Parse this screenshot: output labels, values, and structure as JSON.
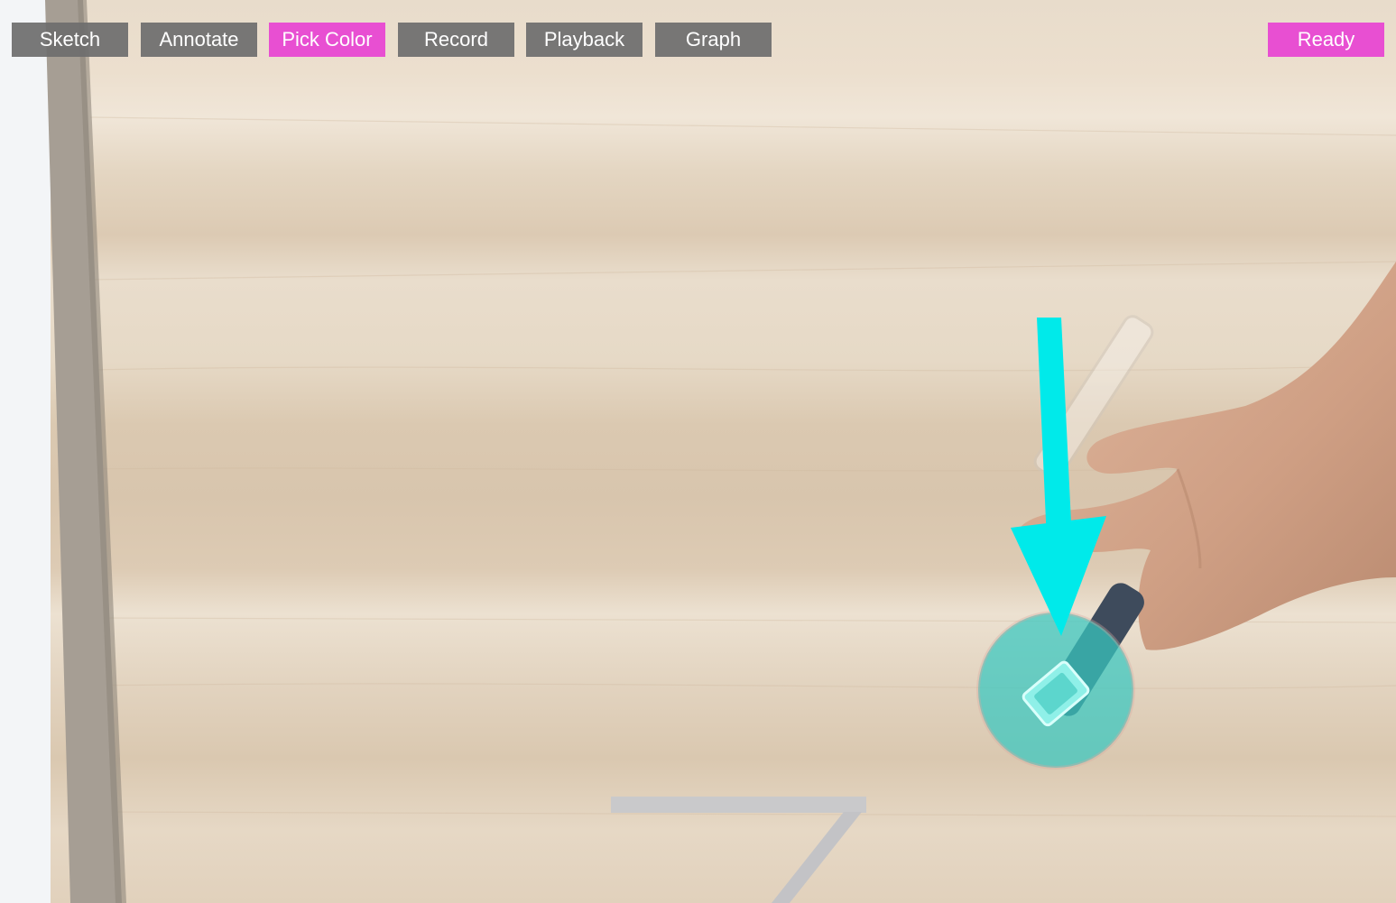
{
  "toolbar": {
    "buttons": [
      {
        "id": "sketch",
        "label": "Sketch",
        "active": false
      },
      {
        "id": "annotate",
        "label": "Annotate",
        "active": false
      },
      {
        "id": "pick_color",
        "label": "Pick Color",
        "active": true
      },
      {
        "id": "record",
        "label": "Record",
        "active": false
      },
      {
        "id": "playback",
        "label": "Playback",
        "active": false
      },
      {
        "id": "graph",
        "label": "Graph",
        "active": false
      }
    ],
    "status_label": "Ready"
  },
  "overlay": {
    "arrow_color": "#00eaea",
    "marker_color": "#3cc9c0",
    "accent_color": "#e84fd2"
  }
}
